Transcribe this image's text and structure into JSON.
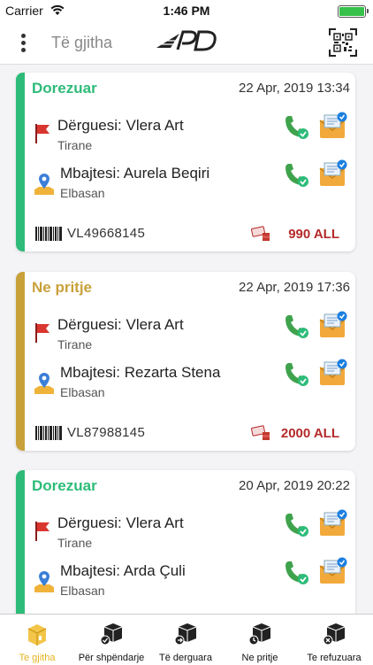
{
  "status_bar": {
    "carrier": "Carrier",
    "time": "1:46 PM"
  },
  "header": {
    "filter_title": "Të gjitha",
    "logo_text": "APD"
  },
  "colors": {
    "delivered": "#2ebb79",
    "pending": "#c9a13b",
    "amount": "#b42a2a",
    "tab_active": "#e6b21e"
  },
  "shipments": [
    {
      "status": "Dorezuar",
      "datetime": "22 Apr, 2019 13:34",
      "sender_title": "Dërguesi: Vlera Art",
      "sender_city": "Tirane",
      "receiver_title": "Mbajtesi: Aurela Beqiri",
      "receiver_city": "Elbasan",
      "code": "VL49668145",
      "amount": "990 ALL"
    },
    {
      "status": "Ne pritje",
      "datetime": "22 Apr, 2019 17:36",
      "sender_title": "Dërguesi: Vlera Art",
      "sender_city": "Tirane",
      "receiver_title": "Mbajtesi: Rezarta Stena",
      "receiver_city": "Elbasan",
      "code": "VL87988145",
      "amount": "2000 ALL"
    },
    {
      "status": "Dorezuar",
      "datetime": "20 Apr, 2019 20:22",
      "sender_title": "Dërguesi: Vlera Art",
      "sender_city": "Tirane",
      "receiver_title": "Mbajtesi: Arda Çuli",
      "receiver_city": "Elbasan"
    }
  ],
  "tabs": [
    {
      "label": "Te gjitha",
      "icon": "box-icon",
      "active": true
    },
    {
      "label": "Për shpëndarje",
      "icon": "delivery-box-icon"
    },
    {
      "label": "Të derguara",
      "icon": "delivered-box-icon"
    },
    {
      "label": "Ne pritje",
      "icon": "pending-box-icon"
    },
    {
      "label": "Te refuzuara",
      "icon": "refused-box-icon"
    }
  ]
}
